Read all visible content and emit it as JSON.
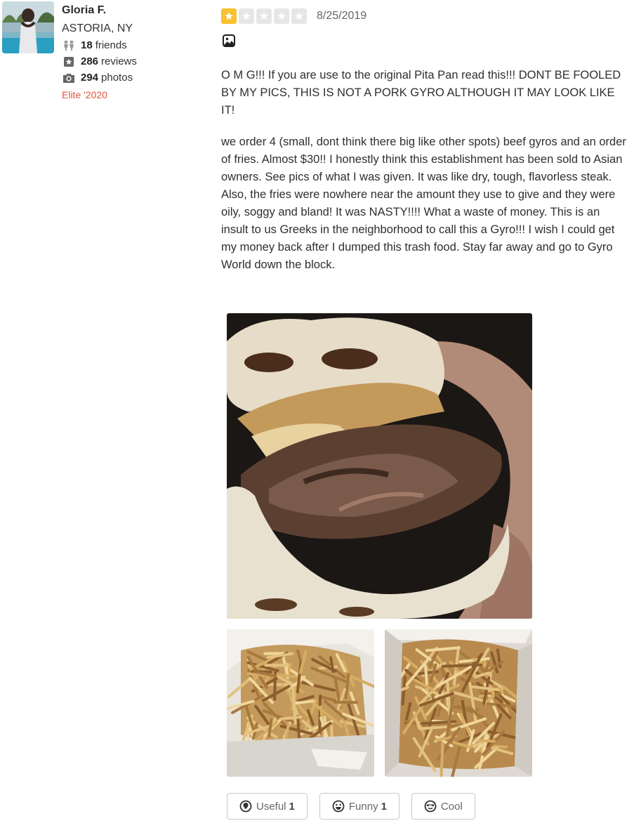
{
  "user": {
    "name": "Gloria F.",
    "location": "ASTORIA, NY",
    "friends_count": "18",
    "friends_label": "friends",
    "reviews_count": "286",
    "reviews_label": "reviews",
    "photos_count": "294",
    "photos_label": "photos",
    "elite": "Elite '2020"
  },
  "review": {
    "rating": 1,
    "rating_max": 5,
    "date": "8/25/2019",
    "paragraphs": [
      "O M G!!! If you are use to the original Pita Pan read this!!! DONT BE FOOLED BY MY PICS, THIS IS NOT A PORK GYRO ALTHOUGH IT MAY LOOK LIKE IT!",
      "we order 4 (small, dont think there big like other spots) beef gyros and an order of fries. Almost $30!! I honestly think this establishment has been sold to Asian owners. See pics of what I was given. It was like dry, tough, flavorless steak.  Also, the fries were nowhere near the amount they use to give and they were oily, soggy and bland! It was NASTY!!!! What a waste of money. This is an insult to us Greeks in the neighborhood to call this a Gyro!!! I wish I could get my money back after I dumped this trash food. Stay far away and go to Gyro World down the block."
    ]
  },
  "photos": [
    {
      "subject": "gyro-photo"
    },
    {
      "subject": "fries-photo"
    },
    {
      "subject": "fries-photo"
    }
  ],
  "votes": {
    "useful_label": "Useful",
    "useful_count": "1",
    "funny_label": "Funny",
    "funny_count": "1",
    "cool_label": "Cool"
  },
  "colors": {
    "star_on": "#f7c12f",
    "star_off": "#e6e6e6",
    "elite": "#e0533f"
  }
}
